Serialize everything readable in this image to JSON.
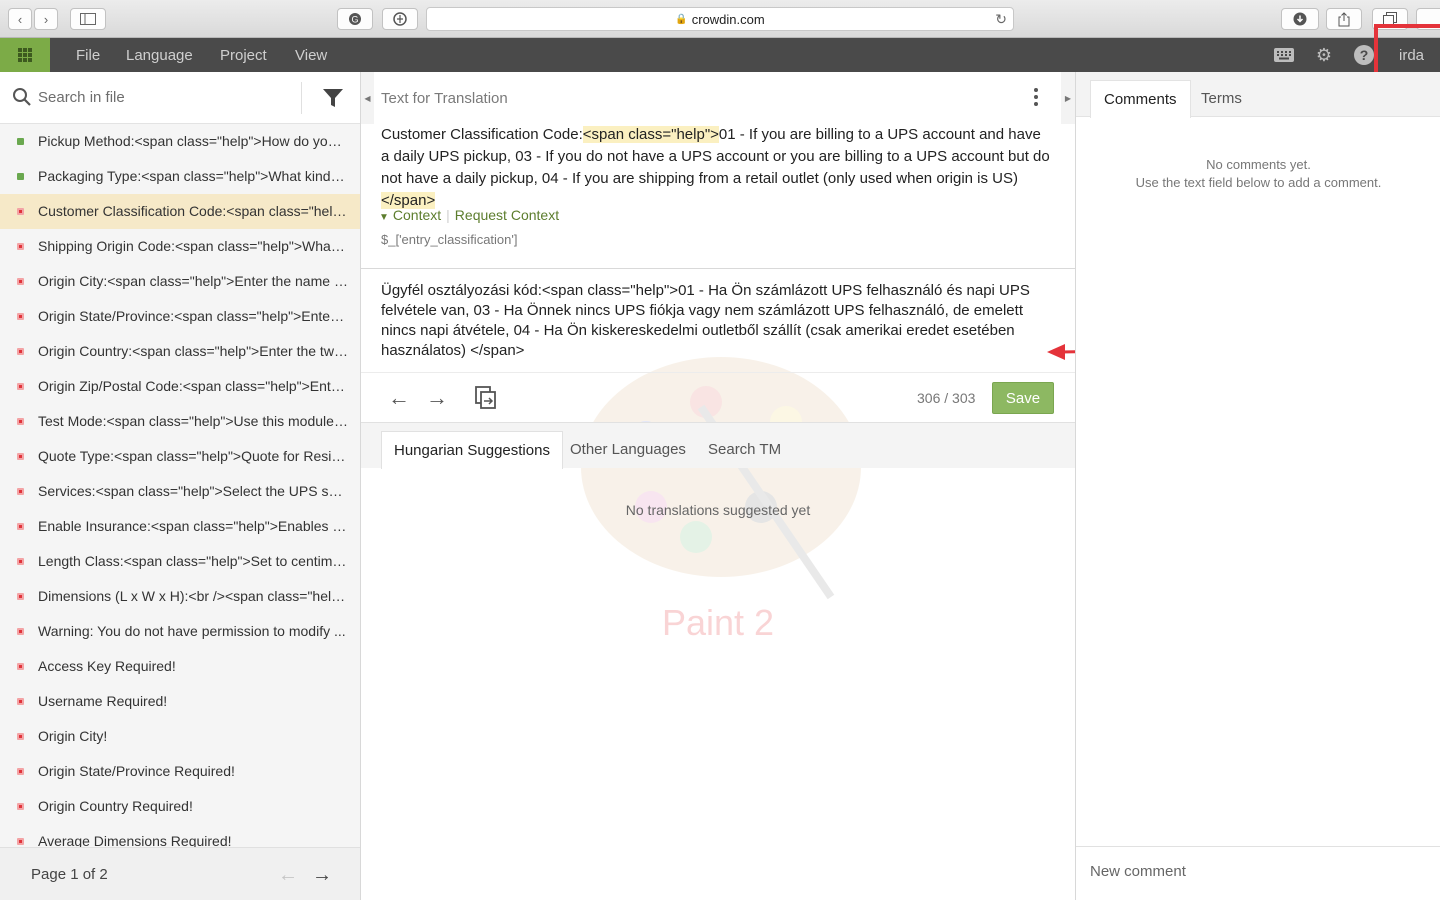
{
  "browser": {
    "url": "crowdin.com"
  },
  "menu": {
    "items": [
      "File",
      "Language",
      "Project",
      "View"
    ],
    "user": "irda"
  },
  "sidebar": {
    "search_placeholder": "Search in file",
    "strings": [
      {
        "text": "Pickup Method:<span class=\"help\">How do you g...",
        "status": "translated"
      },
      {
        "text": "Packaging Type:<span class=\"help\">What kind of ...",
        "status": "translated"
      },
      {
        "text": "Customer Classification Code:<span class=\"help\"...",
        "status": "untranslated",
        "active": true
      },
      {
        "text": "Shipping Origin Code:<span class=\"help\">What o...",
        "status": "untranslated"
      },
      {
        "text": "Origin City:<span class=\"help\">Enter the name of...",
        "status": "untranslated"
      },
      {
        "text": "Origin State/Province:<span class=\"help\">Enter t...",
        "status": "untranslated"
      },
      {
        "text": "Origin Country:<span class=\"help\">Enter the two-...",
        "status": "untranslated"
      },
      {
        "text": "Origin Zip/Postal Code:<span class=\"help\">Enter ...",
        "status": "untranslated"
      },
      {
        "text": "Test Mode:<span class=\"help\">Use this module i...",
        "status": "untranslated"
      },
      {
        "text": "Quote Type:<span class=\"help\">Quote for Reside...",
        "status": "untranslated"
      },
      {
        "text": "Services:<span class=\"help\">Select the UPS servic...",
        "status": "untranslated"
      },
      {
        "text": "Enable Insurance:<span class=\"help\">Enables ins...",
        "status": "untranslated"
      },
      {
        "text": "Length Class:<span class=\"help\">Set to centimete...",
        "status": "untranslated"
      },
      {
        "text": "Dimensions (L x W x H):<br /><span class=\"help\">...",
        "status": "untranslated"
      },
      {
        "text": "Warning: You do not have permission to modify ...",
        "status": "untranslated"
      },
      {
        "text": "Access Key Required!",
        "status": "untranslated"
      },
      {
        "text": "Username Required!",
        "status": "untranslated"
      },
      {
        "text": "Origin City!",
        "status": "untranslated"
      },
      {
        "text": "Origin State/Province Required!",
        "status": "untranslated"
      },
      {
        "text": "Origin Country Required!",
        "status": "untranslated"
      },
      {
        "text": "Average Dimensions Required!",
        "status": "untranslated"
      }
    ],
    "page_label": "Page 1 of 2"
  },
  "editor": {
    "source_heading": "Text for Translation",
    "source_parts": {
      "p1": "Customer Classification Code:",
      "tag_open": "<span class=\"help\">",
      "p2": "01 - If you are billing to a UPS account and have a daily UPS pickup, 03 - If you do not have a UPS account or you are billing to a UPS account but do not have a daily pickup, 04 - If you are shipping from a retail outlet (only used when origin is US)",
      "tag_close": "</span>"
    },
    "context_label": "Context",
    "request_context_label": "Request Context",
    "string_key": "$_['entry_classification']",
    "translation": "Ügyfél osztályozási kód:<span class=\"help\">01 - Ha Ön számlázott UPS felhasználó és napi UPS felvétele van, 03 - Ha Önnek nincs UPS fiókja vagy nem számlázott UPS felhasználó, de emelett nincs napi átvétele, 04 - Ha Ön kiskereskedelmi outletből szállít (csak amerikai eredet esetében használatos) </span>",
    "char_count": "306 / 303",
    "save_label": "Save",
    "tabs": [
      "Hungarian Suggestions",
      "Other Languages",
      "Search TM"
    ],
    "no_suggestions": "No translations suggested yet",
    "watermark_text": "Paint 2"
  },
  "comments": {
    "tabs": [
      "Comments",
      "Terms"
    ],
    "empty_line1": "No comments yet.",
    "empty_line2": "Use the text field below to add a comment.",
    "new_comment_placeholder": "New comment"
  },
  "colors": {
    "accent_green": "#7cab47",
    "save_green": "#8db862",
    "annotation_red": "#e4333a",
    "topbar": "#4a4a4a"
  },
  "icons": [
    "back-icon",
    "forward-icon",
    "sidebar-icon",
    "grammarly-icon",
    "shield-icon",
    "lock-icon",
    "reload-icon",
    "download-icon",
    "share-icon",
    "tabs-icon",
    "apps-grid-icon",
    "keyboard-icon",
    "gear-icon",
    "help-icon",
    "search-icon",
    "filter-icon",
    "kebab-icon",
    "arrow-left-icon",
    "arrow-right-icon",
    "copy-source-icon"
  ]
}
